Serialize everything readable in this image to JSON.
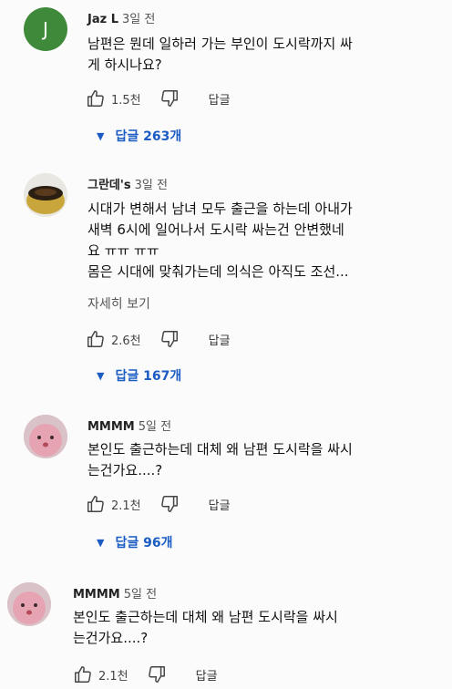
{
  "comments": [
    {
      "author": "Jaz L",
      "time": "3일 전",
      "avatar_letter": "J",
      "lines": [
        "남편은 뭔데 일하러 가는 부인이 도시락까지 싸",
        "게 하시나요?"
      ],
      "likes": "1.5천",
      "reply_label": "답글",
      "replies_label": "답글 263개"
    },
    {
      "author": "그란데's",
      "time": "3일 전",
      "lines": [
        "시대가 변해서 남녀 모두 출근을 하는데 아내가",
        "새벽 6시에 일어나서 도시락 싸는건 안변했네",
        "요 ㅠㅠ ㅠㅠ",
        "몸은 시대에 맞춰가는데 의식은 아직도 조선..."
      ],
      "more_label": "자세히 보기",
      "likes": "2.6천",
      "reply_label": "답글",
      "replies_label": "답글 167개"
    },
    {
      "author": "MMMM",
      "time": "5일 전",
      "lines": [
        "본인도 출근하는데 대체 왜 남편 도시락을 싸시",
        "는건가요....?"
      ],
      "likes": "2.1천",
      "reply_label": "답글",
      "replies_label": "답글 96개"
    },
    {
      "author": "MMMM",
      "time": "5일 전",
      "lines": [
        "본인도 출근하는데 대체 왜 남편 도시락을 싸시",
        "는건가요....?"
      ],
      "likes": "2.1천",
      "reply_label": "답글"
    }
  ]
}
